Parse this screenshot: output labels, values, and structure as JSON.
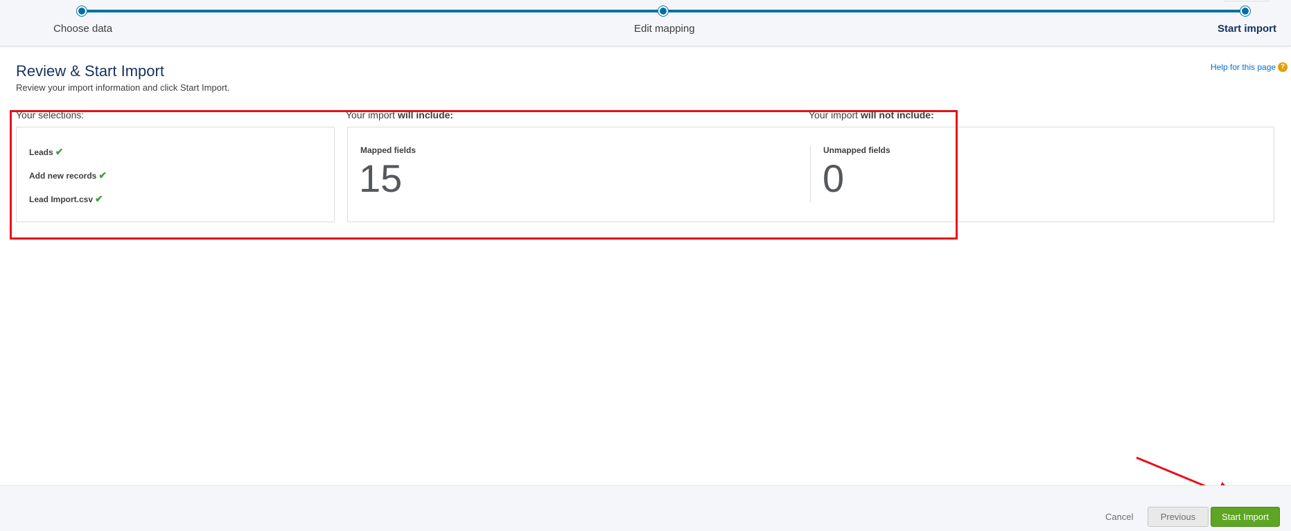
{
  "progress": {
    "steps": [
      {
        "label": "Choose data"
      },
      {
        "label": "Edit mapping"
      },
      {
        "label": "Start import"
      }
    ]
  },
  "header": {
    "title": "Review & Start Import",
    "subtitle": "Review your import information and click Start Import.",
    "help_link": "Help for this page",
    "help_icon_glyph": "?"
  },
  "selections": {
    "heading": "Your selections:",
    "items": [
      {
        "label": "Leads",
        "icon": "checkmark-icon"
      },
      {
        "label": "Add new records",
        "icon": "checkmark-icon"
      },
      {
        "label": "Lead Import.csv",
        "icon": "checkmark-icon"
      }
    ],
    "check_glyph": "✔"
  },
  "include": {
    "heading_prefix": "Your import",
    "heading_bold": "will include:",
    "label": "Mapped fields",
    "value": "15"
  },
  "exclude": {
    "heading_prefix": "Your import",
    "heading_bold": "will not include:",
    "label": "Unmapped fields",
    "value": "0"
  },
  "footer": {
    "cancel_label": "Cancel",
    "previous_label": "Previous",
    "start_label": "Start Import"
  },
  "colors": {
    "accent": "#0070a2",
    "start_button": "#5da523",
    "annotation": "#e8101a"
  }
}
